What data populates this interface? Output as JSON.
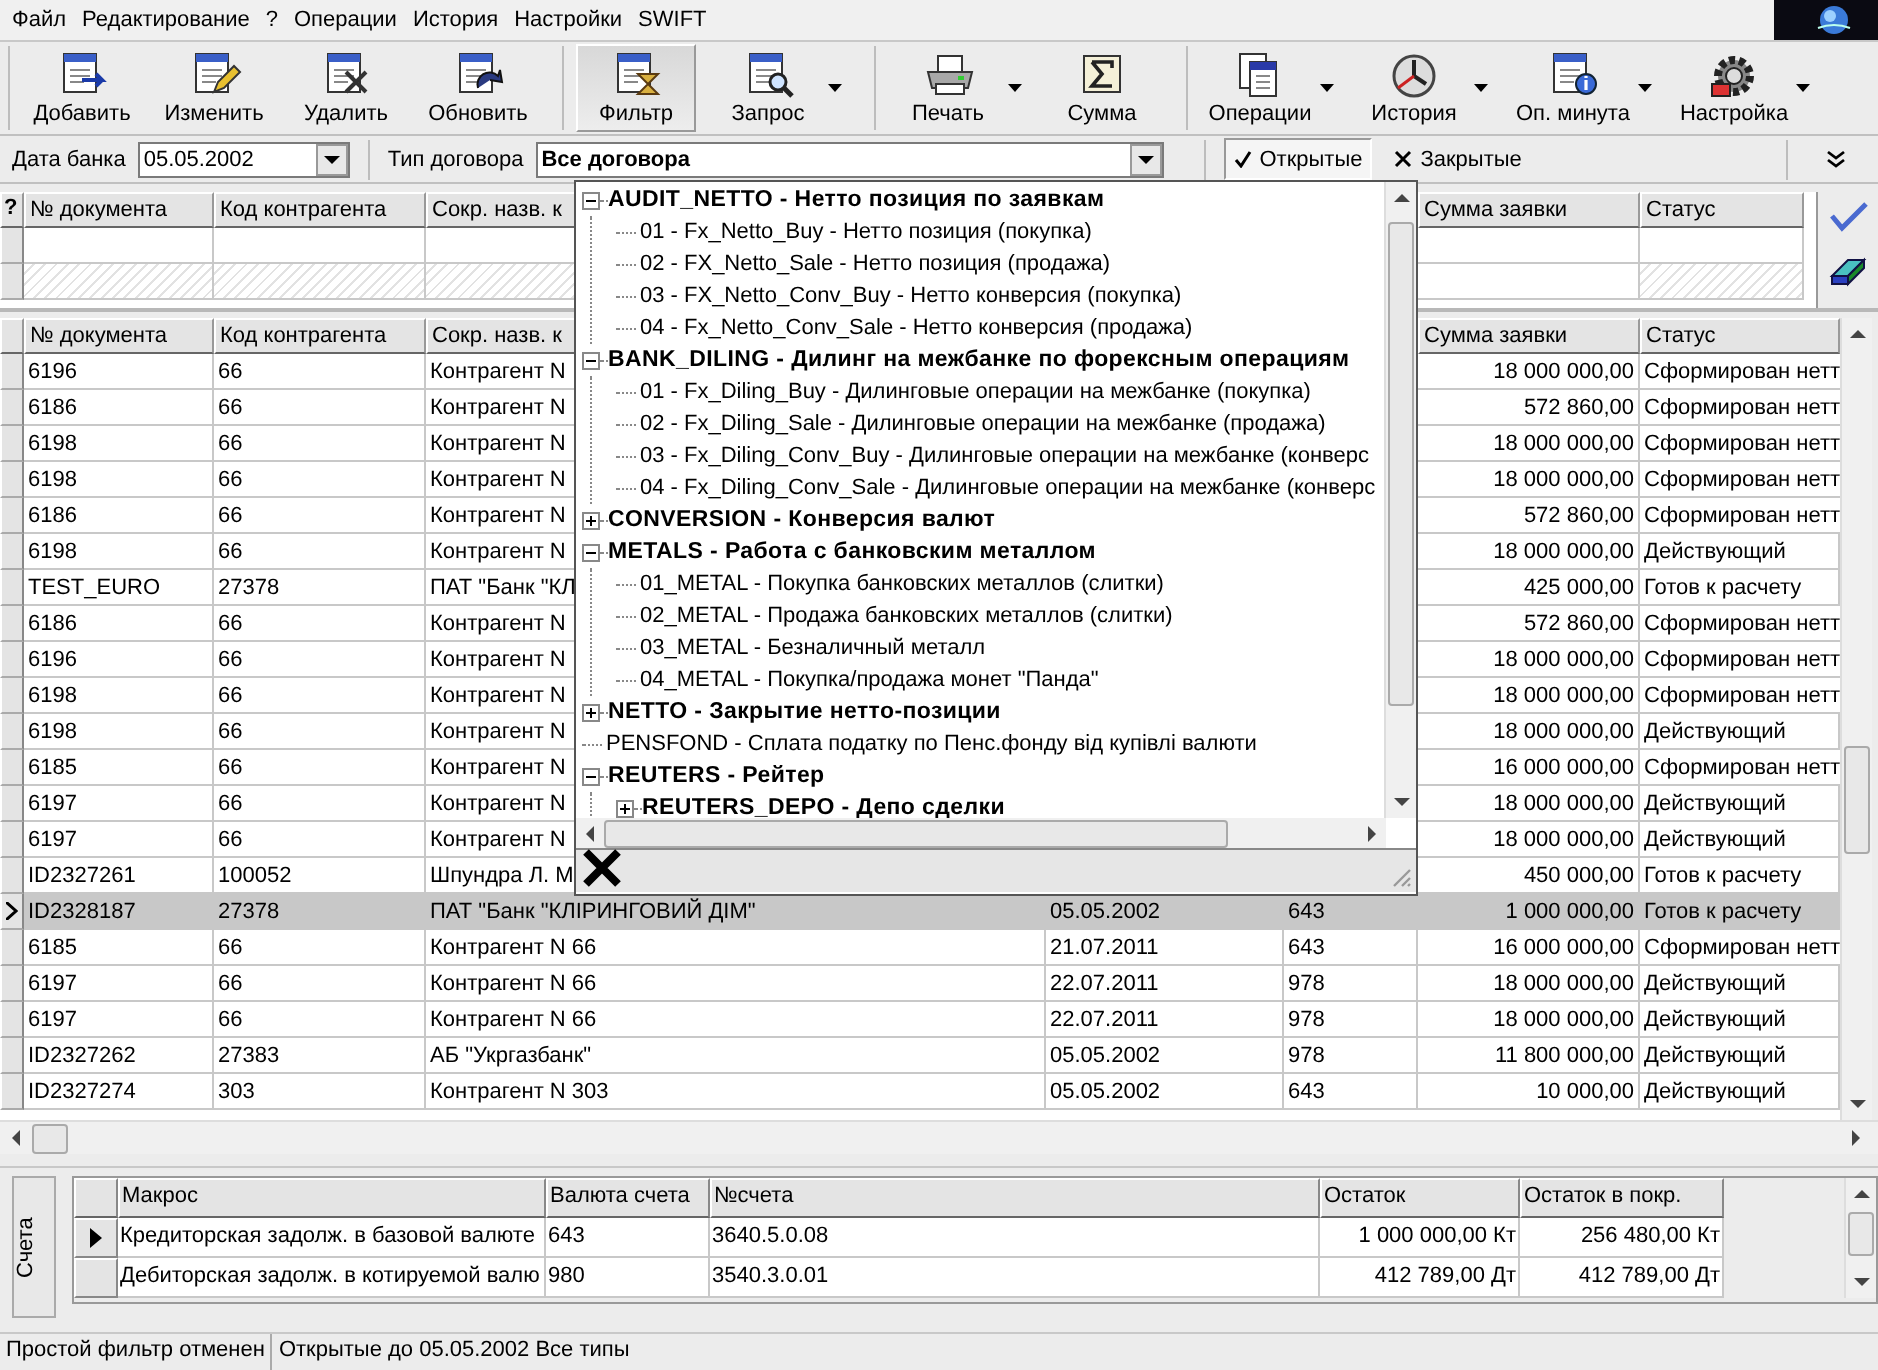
{
  "menu": [
    "Файл",
    "Редактирование",
    "?",
    "Операции",
    "История",
    "Настройки",
    "SWIFT"
  ],
  "toolbar": [
    [
      {
        "label": "Добавить",
        "pressed": false,
        "menu": false
      },
      {
        "label": "Изменить",
        "pressed": false,
        "menu": false
      },
      {
        "label": "Удалить",
        "pressed": false,
        "menu": false
      },
      {
        "label": "Обновить",
        "pressed": false,
        "menu": false
      }
    ],
    [
      {
        "label": "Фильтр",
        "pressed": true,
        "menu": false
      },
      {
        "label": "Запрос",
        "pressed": false,
        "menu": true
      }
    ],
    [
      {
        "label": "Печать",
        "pressed": false,
        "menu": true
      },
      {
        "label": "Сумма",
        "pressed": false,
        "menu": false
      }
    ],
    [
      {
        "label": "Операции",
        "pressed": false,
        "menu": true
      },
      {
        "label": "История",
        "pressed": false,
        "menu": true
      },
      {
        "label": "Оп. минута",
        "pressed": false,
        "menu": true
      },
      {
        "label": "Настройка",
        "pressed": false,
        "menu": true
      }
    ]
  ],
  "filter_bar": {
    "date_label": "Дата банка",
    "date_value": "05.05.2002",
    "type_label": "Тип договора",
    "type_value": "Все договора",
    "toggles": [
      {
        "label": "Открытые",
        "selected": true
      },
      {
        "label": "Закрытые",
        "selected": false
      }
    ]
  },
  "filter_grid": {
    "marker": "?",
    "columns": {
      "document_no": "№ документа",
      "counterparty_code": "Код контрагента",
      "short_name": "Сокр. назв. к",
      "amount": "Сумма заявки",
      "status": "Статус"
    }
  },
  "grid": {
    "columns": {
      "document_no": "№ документа",
      "counterparty_code": "Код контрагента",
      "short_name": "Сокр. назв. к",
      "amount": "Сумма заявки",
      "status": "Статус"
    },
    "rows": [
      {
        "document_no": "6196",
        "counterparty_code": "66",
        "short_name": "Контрагент N",
        "amount": "18 000 000,00",
        "status": "Сформирован нетт",
        "selected": false
      },
      {
        "document_no": "6186",
        "counterparty_code": "66",
        "short_name": "Контрагент N",
        "amount": "572 860,00",
        "status": "Сформирован нетт",
        "selected": false
      },
      {
        "document_no": "6198",
        "counterparty_code": "66",
        "short_name": "Контрагент N",
        "amount": "18 000 000,00",
        "status": "Сформирован нетт",
        "selected": false
      },
      {
        "document_no": "6198",
        "counterparty_code": "66",
        "short_name": "Контрагент N",
        "amount": "18 000 000,00",
        "status": "Сформирован нетт",
        "selected": false
      },
      {
        "document_no": "6186",
        "counterparty_code": "66",
        "short_name": "Контрагент N",
        "amount": "572 860,00",
        "status": "Сформирован нетт",
        "selected": false
      },
      {
        "document_no": "6198",
        "counterparty_code": "66",
        "short_name": "Контрагент N",
        "amount": "18 000 000,00",
        "status": "Действующий",
        "selected": false
      },
      {
        "document_no": "TEST_EURO",
        "counterparty_code": "27378",
        "short_name": "ПАТ \"Банк \"КЛ",
        "amount": "425 000,00",
        "status": "Готов к расчету",
        "selected": false
      },
      {
        "document_no": "6186",
        "counterparty_code": "66",
        "short_name": "Контрагент N",
        "amount": "572 860,00",
        "status": "Сформирован нетт",
        "selected": false
      },
      {
        "document_no": "6196",
        "counterparty_code": "66",
        "short_name": "Контрагент N",
        "amount": "18 000 000,00",
        "status": "Сформирован нетт",
        "selected": false
      },
      {
        "document_no": "6198",
        "counterparty_code": "66",
        "short_name": "Контрагент N",
        "amount": "18 000 000,00",
        "status": "Сформирован нетт",
        "selected": false
      },
      {
        "document_no": "6198",
        "counterparty_code": "66",
        "short_name": "Контрагент N",
        "amount": "18 000 000,00",
        "status": "Действующий",
        "selected": false
      },
      {
        "document_no": "6185",
        "counterparty_code": "66",
        "short_name": "Контрагент N",
        "amount": "16 000 000,00",
        "status": "Сформирован нетт",
        "selected": false
      },
      {
        "document_no": "6197",
        "counterparty_code": "66",
        "short_name": "Контрагент N",
        "amount": "18 000 000,00",
        "status": "Действующий",
        "selected": false
      },
      {
        "document_no": "6197",
        "counterparty_code": "66",
        "short_name": "Контрагент N",
        "amount": "18 000 000,00",
        "status": "Действующий",
        "selected": false
      },
      {
        "document_no": "ID2327261",
        "counterparty_code": "100052",
        "short_name": "Шпундра Л. М",
        "amount": "450 000,00",
        "status": "Готов к расчету",
        "selected": false
      },
      {
        "document_no": "ID2328187",
        "counterparty_code": "27378",
        "short_name": "ПАТ \"Банк \"КЛІРИНГОВИЙ ДІМ\"",
        "date": "05.05.2002",
        "currency": "643",
        "amount": "1 000 000,00",
        "status": "Готов к расчету",
        "selected": true
      },
      {
        "document_no": "6185",
        "counterparty_code": "66",
        "short_name": "Контрагент N 66",
        "date": "21.07.2011",
        "currency": "643",
        "amount": "16 000 000,00",
        "status": "Сформирован нетт",
        "selected": false
      },
      {
        "document_no": "6197",
        "counterparty_code": "66",
        "short_name": "Контрагент N 66",
        "date": "22.07.2011",
        "currency": "978",
        "amount": "18 000 000,00",
        "status": "Действующий",
        "selected": false
      },
      {
        "document_no": "6197",
        "counterparty_code": "66",
        "short_name": "Контрагент N 66",
        "date": "22.07.2011",
        "currency": "978",
        "amount": "18 000 000,00",
        "status": "Действующий",
        "selected": false
      },
      {
        "document_no": "ID2327262",
        "counterparty_code": "27383",
        "short_name": "АБ \"Укргазбанк\"",
        "date": "05.05.2002",
        "currency": "978",
        "amount": "11 800 000,00",
        "status": "Действующий",
        "selected": false
      },
      {
        "document_no": "ID2327274",
        "counterparty_code": "303",
        "short_name": "Контрагент N 303",
        "date": "05.05.2002",
        "currency": "643",
        "amount": "10 000,00",
        "status": "Действующий",
        "selected": false
      }
    ]
  },
  "contract_tree": [
    {
      "kind": "group",
      "label": "AUDIT_NETTO - Нетто позиция по заявкам",
      "expanded": true,
      "children": [
        {
          "kind": "item",
          "label": "01 - Fx_Netto_Buy - Нетто позиция (покупка)"
        },
        {
          "kind": "item",
          "label": "02 - FX_Netto_Sale - Нетто позиция (продажа)"
        },
        {
          "kind": "item",
          "label": "03 - FX_Netto_Conv_Buy - Нетто конверсия (покупка)"
        },
        {
          "kind": "item",
          "label": "04 - Fx_Netto_Conv_Sale - Нетто конверсия (продажа)"
        }
      ]
    },
    {
      "kind": "group",
      "label": "BANK_DILING - Дилинг на межбанке по форексным операциям",
      "expanded": true,
      "children": [
        {
          "kind": "item",
          "label": "01 - Fx_Diling_Buy - Дилинговые операции на межбанке (покупка)"
        },
        {
          "kind": "item",
          "label": "02 - Fx_Diling_Sale - Дилинговые операции на межбанке (продажа)"
        },
        {
          "kind": "item",
          "label": "03 - Fx_Diling_Conv_Buy - Дилинговые операции на межбанке (конверс"
        },
        {
          "kind": "item",
          "label": "04 - Fx_Diling_Conv_Sale - Дилинговые операции на межбанке (конверс"
        }
      ]
    },
    {
      "kind": "group",
      "label": "CONVERSION - Конверсия валют",
      "expanded": false
    },
    {
      "kind": "group",
      "label": "METALS - Работа с банковским металлом",
      "expanded": true,
      "children": [
        {
          "kind": "item",
          "label": "01_METAL - Покупка банковских металлов (слитки)"
        },
        {
          "kind": "item",
          "label": "02_METAL - Продажа банковских металлов (слитки)"
        },
        {
          "kind": "item",
          "label": "03_METAL - Безналичный металл"
        },
        {
          "kind": "item",
          "label": "04_METAL - Покупка/продажа монет \"Панда\""
        }
      ]
    },
    {
      "kind": "group",
      "label": "NETTO - Закрытие нетто-позиции",
      "expanded": false
    },
    {
      "kind": "item",
      "label": "PENSFOND - Сплата податку по Пенс.фонду від купівлі валюти"
    },
    {
      "kind": "group",
      "label": "REUTERS - Рейтер",
      "expanded": true,
      "children": [
        {
          "kind": "group",
          "label": "REUTERS_DEPO - Депо сделки",
          "expanded": false
        }
      ]
    }
  ],
  "accounts": {
    "tab": "Счета",
    "columns": [
      "Макрос",
      "Валюта счета",
      "№счета",
      "Остаток",
      "Остаток в покр."
    ],
    "rows": [
      {
        "cells": [
          "Кредиторская задолж. в базовой валюте",
          "643",
          "3640.5.0.08",
          "1 000 000,00 Кт",
          "256 480,00 Кт"
        ],
        "selected": true
      },
      {
        "cells": [
          "Дебиторская задолж. в котируемой валю",
          "980",
          "3540.3.0.01",
          "412 789,00 Дт",
          "412 789,00 Дт"
        ],
        "selected": false
      }
    ]
  },
  "status_bar": [
    "Простой фильтр отменен",
    "Открытые до 05.05.2002 Все типы"
  ]
}
